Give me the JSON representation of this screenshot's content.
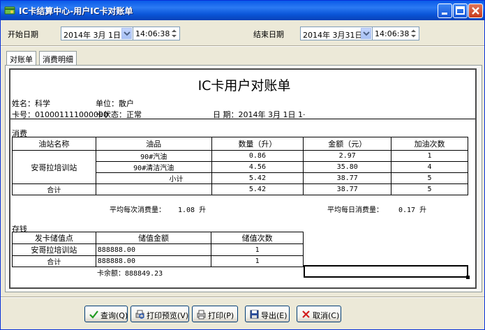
{
  "window": {
    "title": "IC卡结算中心-用户IC卡对账单"
  },
  "filters": {
    "start_label": "开始日期",
    "start_date": "2014年  3月  1日",
    "start_time": "14:06:38",
    "end_label": "结束日期",
    "end_date": "2014年  3月31日",
    "end_time": "14:06:38"
  },
  "tabs": [
    "对账单",
    "消费明细"
  ],
  "report": {
    "title": "IC卡用户对账单",
    "name_line": "姓名：科学",
    "unit_line": "单位：散户",
    "card_no_line": "卡号：010001111000000",
    "card_status_line": "卡状态：正常",
    "date_line": "日 期：2014年 3月 1日 1·",
    "consume_section": "消费",
    "consume_headers": [
      "油站名称",
      "油品",
      "数量（升）",
      "金额（元）",
      "加油次数"
    ],
    "consume_station": "安哥拉培训站",
    "consume_rows": [
      {
        "product": "90#汽油",
        "qty": "0.86",
        "amount": "2.97",
        "count": "1"
      },
      {
        "product": "90#清洁汽油",
        "qty": "4.56",
        "amount": "35.80",
        "count": "4"
      },
      {
        "product": "小计",
        "qty": "5.42",
        "amount": "38.77",
        "count": "5"
      }
    ],
    "consume_total": {
      "label": "合计",
      "qty": "5.42",
      "amount": "38.77",
      "count": "5"
    },
    "avg_each_label": "平均每次消费量：",
    "avg_each_value": "1.08 升",
    "avg_day_label": "平均每日消费量：",
    "avg_day_value": "0.17 升",
    "deposit_section": "存钱",
    "deposit_headers": [
      "发卡储值点",
      "储值金额",
      "储值次数"
    ],
    "deposit_rows": [
      {
        "site": "安哥拉培训站",
        "amount": "888888.00",
        "count": "1"
      }
    ],
    "deposit_total": {
      "label": "合计",
      "amount": "888888.00",
      "count": "1"
    },
    "balance_line": "卡余额：888849.23"
  },
  "buttons": {
    "query": "查询(Q)",
    "preview": "打印预览(V)",
    "print": "打印(P)",
    "export": "导出(E)",
    "cancel": "取消(C)"
  },
  "colors": {
    "titlebar": "#0a5ae8",
    "window_bg": "#ece9d8",
    "close_button": "#c8391a"
  }
}
